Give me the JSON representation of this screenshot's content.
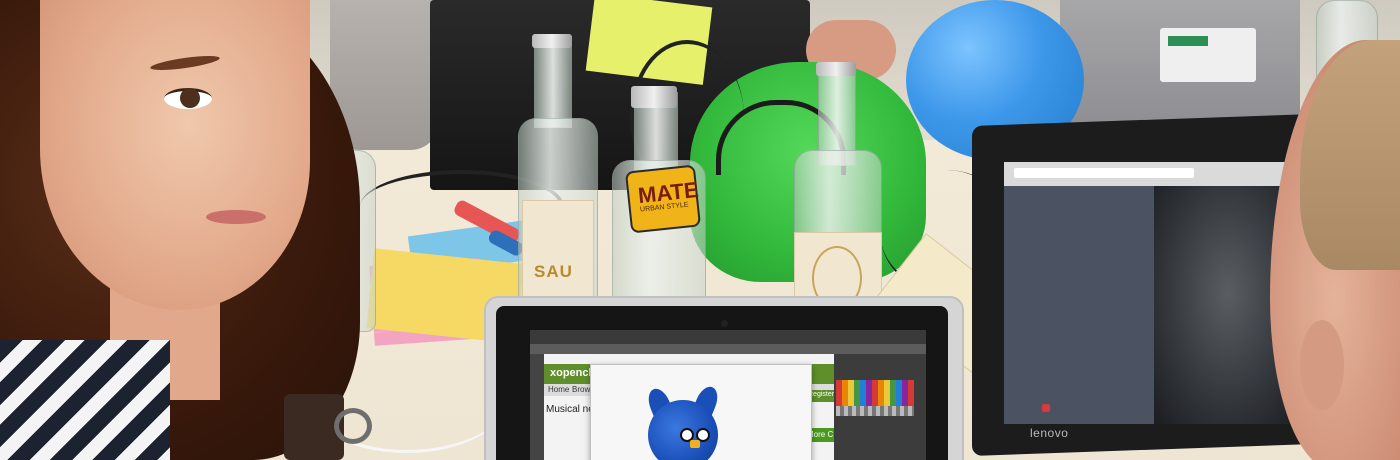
{
  "bottles": {
    "left_label": "SAU",
    "mate_brand": "MATE",
    "mate_sub": "URBAN STYLE"
  },
  "macbook": {
    "site_logo": "xopencl",
    "nav_home": "Home",
    "nav_browse": "Browse",
    "body_text": "Musical no",
    "register": "Register",
    "more": "More C"
  },
  "lenovo": {
    "logo": "lenovo"
  },
  "colors": {
    "balloon": "#3e98ea",
    "bag": "#32b83b",
    "sticky_yellow": "#f5d964",
    "sticky_pink": "#f2a4c1",
    "bird": "#1a4fb8"
  }
}
